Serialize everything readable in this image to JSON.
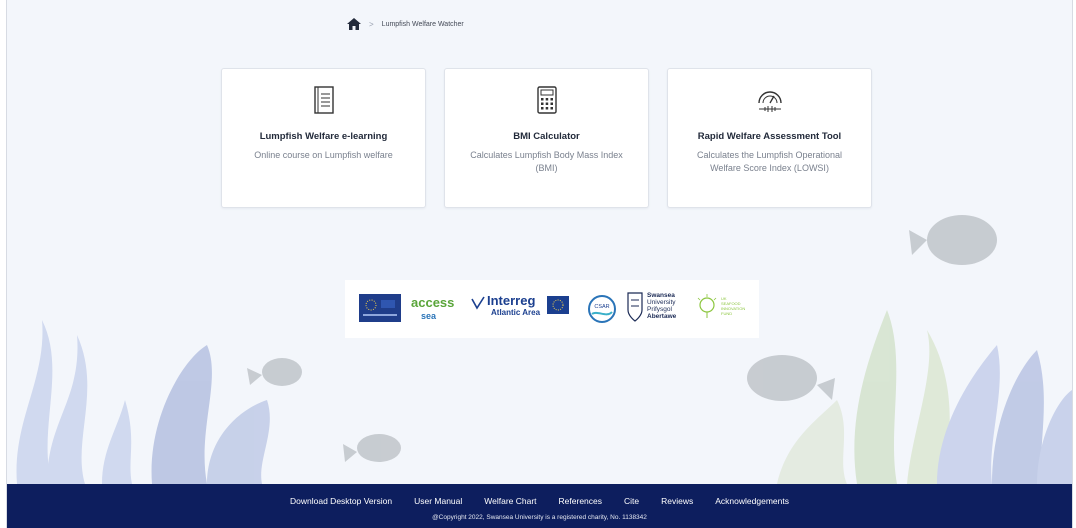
{
  "breadcrumb": {
    "home_icon": "home-icon",
    "separator": ">",
    "current": "Lumpfish Welfare Watcher"
  },
  "cards": [
    {
      "icon": "book-icon",
      "title": "Lumpfish Welfare e-learning",
      "description": "Online course on Lumpfish welfare"
    },
    {
      "icon": "calculator-icon",
      "title": "BMI Calculator",
      "description": "Calculates Lumpfish Body Mass Index (BMI)"
    },
    {
      "icon": "gauge-icon",
      "title": "Rapid Welfare Assessment Tool",
      "description": "Calculates the Lumpfish Operational Welfare Score Index (LOWSI)"
    }
  ],
  "partners": {
    "access": "access",
    "access_sub": "sea",
    "interreg": "Interreg",
    "interreg_sub": "Atlantic Area",
    "csar": "CSAR",
    "swansea_1": "Swansea",
    "swansea_2": "University",
    "swansea_3": "Prifysgol",
    "swansea_4": "Abertawe",
    "fund_1": "UK",
    "fund_2": "SEAFOOD",
    "fund_3": "INNOVATION",
    "fund_4": "FUND"
  },
  "footer": {
    "links": [
      "Download Desktop Version",
      "User Manual",
      "Welfare Chart",
      "References",
      "Cite",
      "Reviews",
      "Acknowledgements"
    ],
    "copyright": "@Copyright 2022, Swansea University is a registered charity, No. 1138342"
  },
  "colors": {
    "footer_bg": "#0d1e5e",
    "page_bg": "#f3f6fb",
    "seaweed_blue": "#c9d2ea",
    "seaweed_green": "#d9e6d3"
  }
}
